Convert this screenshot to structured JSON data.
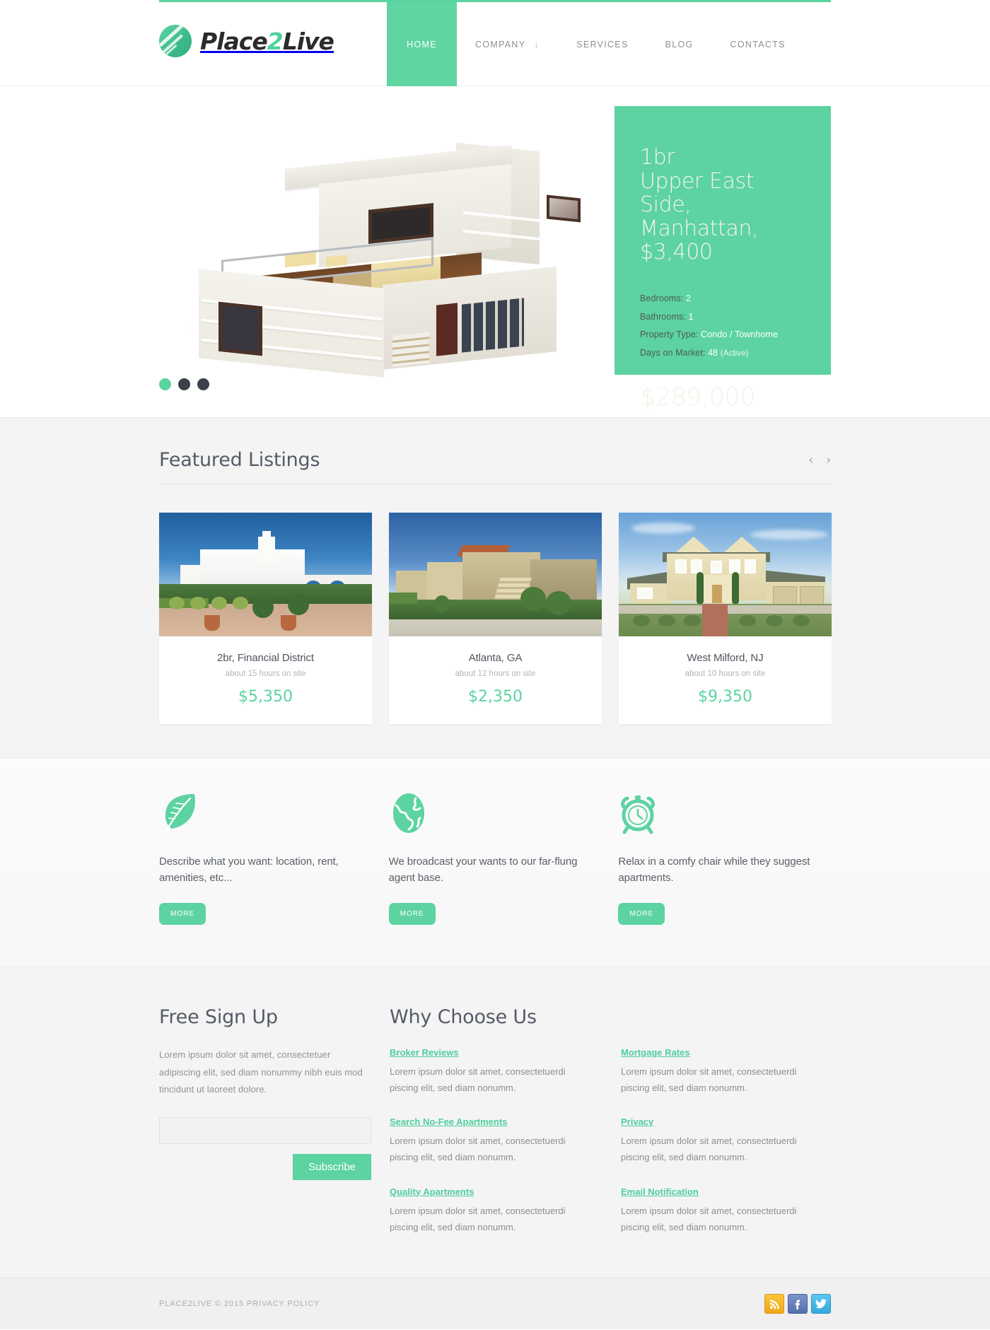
{
  "brand": {
    "name_part1": "Place",
    "name_two": "2",
    "name_part2": "Live",
    "logo_icon": "leaf-circle-icon",
    "accent_color": "#5cd3a1"
  },
  "nav": {
    "items": [
      {
        "label": "HOME",
        "active": true,
        "has_dropdown": false
      },
      {
        "label": "COMPANY",
        "active": false,
        "has_dropdown": true,
        "caret": "↓"
      },
      {
        "label": "SERVICES",
        "active": false,
        "has_dropdown": false
      },
      {
        "label": "BLOG",
        "active": false,
        "has_dropdown": false
      },
      {
        "label": "CONTACTS",
        "active": false,
        "has_dropdown": false
      }
    ]
  },
  "hero": {
    "photo_alt": "modern-white-villa-render",
    "title_line1": "1br",
    "title_line2": "Upper East Side,",
    "title_line3": "Manhattan, $3,400",
    "specs": [
      {
        "label": "Bedrooms:",
        "value": "2",
        "extra": ""
      },
      {
        "label": "Bathrooms:",
        "value": "1",
        "extra": ""
      },
      {
        "label": "Property Type:",
        "value": "Condo / Townhome",
        "extra": ""
      },
      {
        "label": "Days on Market:",
        "value": "48",
        "extra": "(Active)"
      }
    ],
    "price": "$289,000",
    "dots": [
      {
        "active": true
      },
      {
        "active": false
      },
      {
        "active": false
      }
    ]
  },
  "listings": {
    "title": "Featured Listings",
    "prev_arrow": "‹",
    "next_arrow": "›",
    "cards": [
      {
        "image": "mediterranean-white-villa-photo",
        "title": "2br, Financial District",
        "meta": "about 15 hours on site",
        "price": "$5,350"
      },
      {
        "image": "beige-townhomes-photo",
        "title": "Atlanta, GA",
        "meta": "about 12 hours on site",
        "price": "$2,350"
      },
      {
        "image": "yellow-colonial-house-photo",
        "title": "West Milford, NJ",
        "meta": "about 10 hours on site",
        "price": "$9,350"
      }
    ]
  },
  "features": [
    {
      "icon": "leaf-icon",
      "text": "Describe what you want: location, rent, amenities, etc...",
      "button": "MORE"
    },
    {
      "icon": "globe-icon",
      "text": "We broadcast your wants to our far-flung agent base.",
      "button": "MORE"
    },
    {
      "icon": "alarm-clock-icon",
      "text": "Relax in a comfy chair while they suggest apartments.",
      "button": "MORE"
    }
  ],
  "signup": {
    "title": "Free Sign Up",
    "text": "Lorem ipsum dolor sit amet, consectetuer adipiscing elit, sed diam nonummy nibh euis mod tincidunt ut laoreet dolore.",
    "input_value": "",
    "input_placeholder": "",
    "button": "Subscribe"
  },
  "why": {
    "title": "Why Choose Us",
    "items": [
      {
        "link": "Broker Reviews",
        "text": "Lorem ipsum dolor sit amet, consectetuerdi piscing elit, sed diam nonumm."
      },
      {
        "link": "Mortgage Rates",
        "text": "Lorem ipsum dolor sit amet, consectetuerdi piscing elit, sed diam nonumm."
      },
      {
        "link": "Search No-Fee Apartments",
        "text": "Lorem ipsum dolor sit amet, consectetuerdi piscing elit, sed diam nonumm."
      },
      {
        "link": "Privacy",
        "text": "Lorem ipsum dolor sit amet, consectetuerdi piscing elit, sed diam nonumm."
      },
      {
        "link": "Quality Apartments",
        "text": "Lorem ipsum dolor sit amet, consectetuerdi piscing elit, sed diam nonumm."
      },
      {
        "link": "Email Notification",
        "text": "Lorem ipsum dolor sit amet, consectetuerdi piscing elit, sed diam nonumm."
      }
    ]
  },
  "footer": {
    "copyright": "PLACE2LIVE © 2015 PRIVACY POLICY",
    "socials": [
      {
        "name": "rss-icon",
        "glyph": "◖"
      },
      {
        "name": "facebook-icon",
        "glyph": "f"
      },
      {
        "name": "twitter-icon",
        "glyph": "✉"
      }
    ]
  }
}
